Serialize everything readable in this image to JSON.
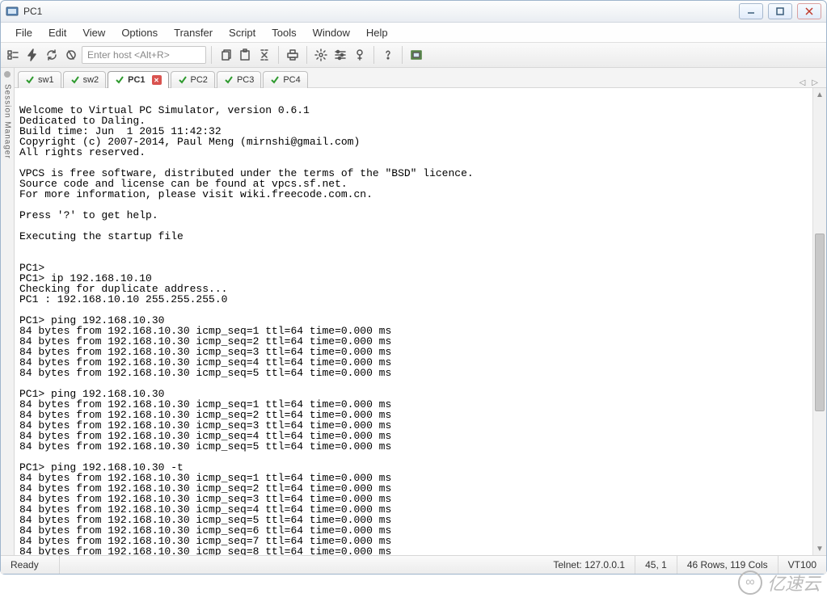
{
  "window": {
    "title": "PC1"
  },
  "menu": [
    "File",
    "Edit",
    "View",
    "Options",
    "Transfer",
    "Script",
    "Tools",
    "Window",
    "Help"
  ],
  "host_input": {
    "placeholder": "Enter host <Alt+R>",
    "value": ""
  },
  "session_panel": {
    "label": "Session Manager"
  },
  "tabs": [
    {
      "label": "sw1",
      "active": false,
      "closeable": false
    },
    {
      "label": "sw2",
      "active": false,
      "closeable": false
    },
    {
      "label": "PC1",
      "active": true,
      "closeable": true
    },
    {
      "label": "PC2",
      "active": false,
      "closeable": false
    },
    {
      "label": "PC3",
      "active": false,
      "closeable": false
    },
    {
      "label": "PC4",
      "active": false,
      "closeable": false
    }
  ],
  "status": {
    "ready": "Ready",
    "conn": "Telnet: 127.0.0.1",
    "cursor": "45,   1",
    "dims": "46 Rows, 119 Cols",
    "term": "VT100"
  },
  "watermark": "亿速云",
  "terminal_lines": [
    "",
    "Welcome to Virtual PC Simulator, version 0.6.1",
    "Dedicated to Daling.",
    "Build time: Jun  1 2015 11:42:32",
    "Copyright (c) 2007-2014, Paul Meng (mirnshi@gmail.com)",
    "All rights reserved.",
    "",
    "VPCS is free software, distributed under the terms of the \"BSD\" licence.",
    "Source code and license can be found at vpcs.sf.net.",
    "For more information, please visit wiki.freecode.com.cn.",
    "",
    "Press '?' to get help.",
    "",
    "Executing the startup file",
    "",
    "",
    "PC1>",
    "PC1> ip 192.168.10.10",
    "Checking for duplicate address...",
    "PC1 : 192.168.10.10 255.255.255.0",
    "",
    "PC1> ping 192.168.10.30",
    "84 bytes from 192.168.10.30 icmp_seq=1 ttl=64 time=0.000 ms",
    "84 bytes from 192.168.10.30 icmp_seq=2 ttl=64 time=0.000 ms",
    "84 bytes from 192.168.10.30 icmp_seq=3 ttl=64 time=0.000 ms",
    "84 bytes from 192.168.10.30 icmp_seq=4 ttl=64 time=0.000 ms",
    "84 bytes from 192.168.10.30 icmp_seq=5 ttl=64 time=0.000 ms",
    "",
    "PC1> ping 192.168.10.30",
    "84 bytes from 192.168.10.30 icmp_seq=1 ttl=64 time=0.000 ms",
    "84 bytes from 192.168.10.30 icmp_seq=2 ttl=64 time=0.000 ms",
    "84 bytes from 192.168.10.30 icmp_seq=3 ttl=64 time=0.000 ms",
    "84 bytes from 192.168.10.30 icmp_seq=4 ttl=64 time=0.000 ms",
    "84 bytes from 192.168.10.30 icmp_seq=5 ttl=64 time=0.000 ms",
    "",
    "PC1> ping 192.168.10.30 -t",
    "84 bytes from 192.168.10.30 icmp_seq=1 ttl=64 time=0.000 ms",
    "84 bytes from 192.168.10.30 icmp_seq=2 ttl=64 time=0.000 ms",
    "84 bytes from 192.168.10.30 icmp_seq=3 ttl=64 time=0.000 ms",
    "84 bytes from 192.168.10.30 icmp_seq=4 ttl=64 time=0.000 ms",
    "84 bytes from 192.168.10.30 icmp_seq=5 ttl=64 time=0.000 ms",
    "84 bytes from 192.168.10.30 icmp_seq=6 ttl=64 time=0.000 ms",
    "84 bytes from 192.168.10.30 icmp_seq=7 ttl=64 time=0.000 ms",
    "84 bytes from 192.168.10.30 icmp_seq=8 ttl=64 time=0.000 ms",
    "▮"
  ]
}
